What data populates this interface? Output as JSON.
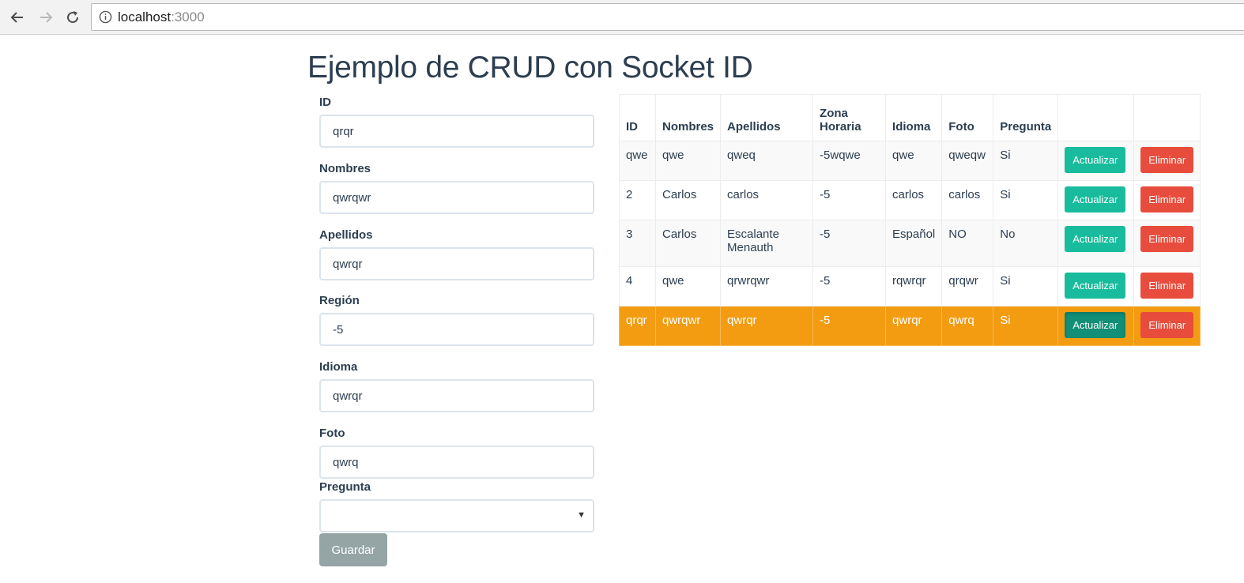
{
  "browser": {
    "url_host": "localhost",
    "url_port": ":3000"
  },
  "page": {
    "title": "Ejemplo de CRUD con Socket ID"
  },
  "form": {
    "fields": [
      {
        "label": "ID",
        "value": "qrqr"
      },
      {
        "label": "Nombres",
        "value": "qwrqwr"
      },
      {
        "label": "Apellidos",
        "value": "qwrqr"
      },
      {
        "label": "Región",
        "value": "-5"
      },
      {
        "label": "Idioma",
        "value": "qwrqr"
      },
      {
        "label": "Foto",
        "value": "qwrq"
      }
    ],
    "select": {
      "label": "Pregunta",
      "value": ""
    },
    "save_label": "Guardar"
  },
  "table": {
    "headers": [
      "ID",
      "Nombres",
      "Apellidos",
      "Zona Horaria",
      "Idioma",
      "Foto",
      "Pregunta"
    ],
    "update_label": "Actualizar",
    "delete_label": "Eliminar",
    "rows": [
      [
        "qwe",
        "qwe",
        "qweq",
        "-5wqwe",
        "qwe",
        "qweqw",
        "Si"
      ],
      [
        "2",
        "Carlos",
        "carlos",
        "-5",
        "carlos",
        "carlos",
        "Si"
      ],
      [
        "3",
        "Carlos",
        "Escalante Menauth",
        "-5",
        "Español",
        "NO",
        "No"
      ],
      [
        "4",
        "qwe",
        "qrwrqwr",
        "-5",
        "rqwrqr",
        "qrqwr",
        "Si"
      ],
      [
        "qrqr",
        "qwrqwr",
        "qwrqr",
        "-5",
        "qwrqr",
        "qwrq",
        "Si"
      ]
    ],
    "highlighted_row": 4
  },
  "colors": {
    "primary": "#2c3e50",
    "success": "#18bc9c",
    "danger": "#e74c3c",
    "warning": "#f39c12",
    "muted": "#95a5a6"
  }
}
